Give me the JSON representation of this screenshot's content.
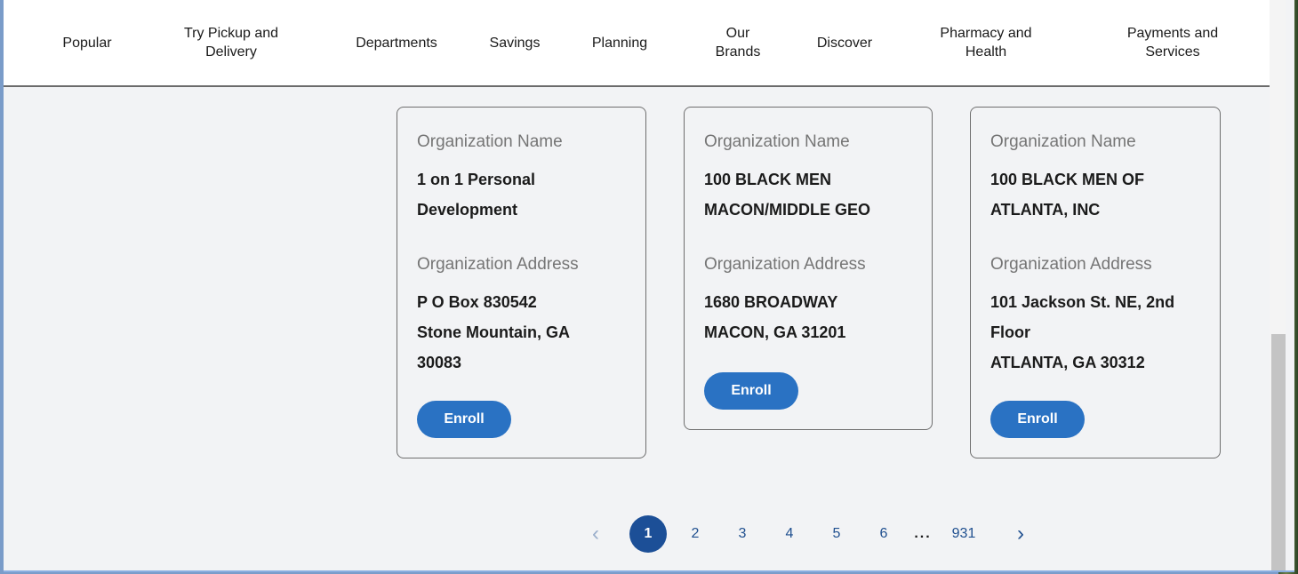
{
  "nav": {
    "items": [
      {
        "label": "Popular"
      },
      {
        "label": "Try Pickup and\nDelivery"
      },
      {
        "label": "Departments"
      },
      {
        "label": "Savings"
      },
      {
        "label": "Planning"
      },
      {
        "label": "Our\nBrands"
      },
      {
        "label": "Discover"
      },
      {
        "label": "Pharmacy and\nHealth"
      },
      {
        "label": "Payments and\nServices"
      }
    ]
  },
  "cards": [
    {
      "name_label": "Organization Name",
      "name": "1 on 1 Personal\nDevelopment",
      "address_label": "Organization Address",
      "address": "P O Box 830542\nStone Mountain, GA\n30083",
      "button": "Enroll"
    },
    {
      "name_label": "Organization Name",
      "name": "100 BLACK MEN\nMACON/MIDDLE GEO",
      "address_label": "Organization Address",
      "address": "1680 BROADWAY\nMACON, GA 31201",
      "button": "Enroll"
    },
    {
      "name_label": "Organization Name",
      "name": "100 BLACK MEN OF\nATLANTA, INC",
      "address_label": "Organization Address",
      "address": "101 Jackson St. NE, 2nd\nFloor\nATLANTA, GA 30312",
      "button": "Enroll"
    }
  ],
  "pagination": {
    "prev": "‹",
    "pages": [
      "1",
      "2",
      "3",
      "4",
      "5",
      "6"
    ],
    "ellipsis": "...",
    "last": "931",
    "next": "›",
    "current": "1"
  },
  "colors": {
    "accent": "#2a72c3",
    "active_page": "#1c4f97"
  }
}
